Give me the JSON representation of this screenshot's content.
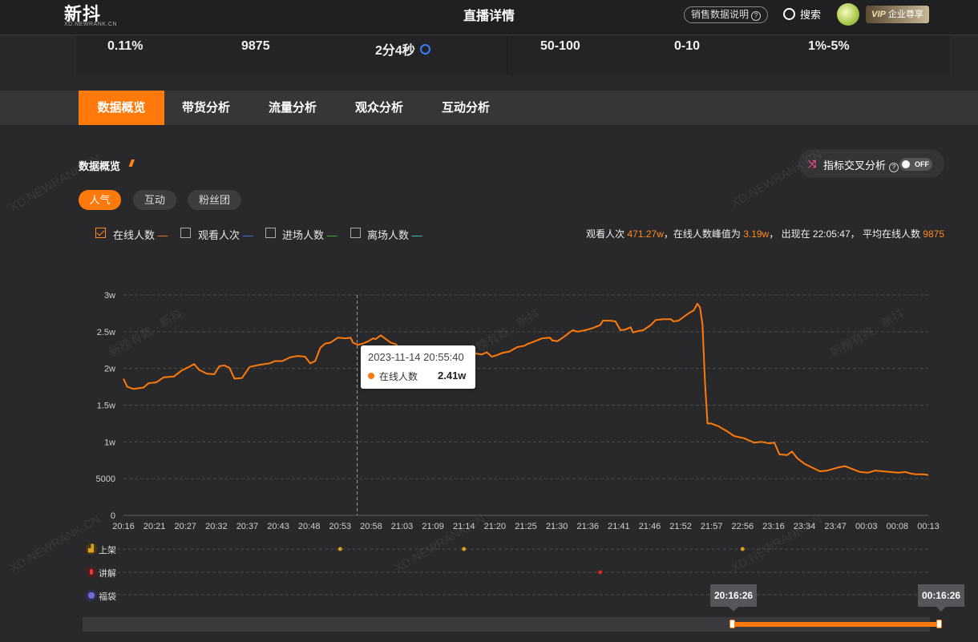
{
  "header": {
    "logo": "新抖",
    "logo_sub": "XD.NEWRANK.CN",
    "title": "直播详情",
    "sales_info": "销售数据说明",
    "search": "搜索",
    "vip_tag": "VIP",
    "vip_label": "企业尊享"
  },
  "metrics": [
    "0.11%",
    "9875",
    "2分4秒",
    "50-100",
    "0-10",
    "1%-5%"
  ],
  "tabs": [
    "数据概览",
    "带货分析",
    "流量分析",
    "观众分析",
    "互动分析"
  ],
  "section": {
    "title": "数据概览",
    "cross_analysis": "指标交叉分析",
    "toggle": "OFF",
    "pills": [
      "人气",
      "互动",
      "粉丝团"
    ]
  },
  "legend": [
    {
      "label": "在线人数",
      "color": "#ff7a0a",
      "checked": true
    },
    {
      "label": "观看人次",
      "color": "#3a7bff",
      "checked": false
    },
    {
      "label": "进场人数",
      "color": "#3fbf3f",
      "checked": false
    },
    {
      "label": "离场人数",
      "color": "#33d6c8",
      "checked": false
    }
  ],
  "summary": {
    "p1": "观看人次 ",
    "views": "471.27w",
    "p2": "，在线人数峰值为 ",
    "peak": "3.19w",
    "p3": "， 出现在 22:05:47， 平均在线人数 ",
    "avg": "9875"
  },
  "tooltip": {
    "time": "2023-11-14 20:55:40",
    "series": "在线人数",
    "value": "2.41w"
  },
  "events": [
    {
      "label": "上架",
      "icon_color": "#d9a11b",
      "icon": "cart-icon",
      "dot_color": "#d9a11b",
      "dots": [
        "20:53",
        "21:14",
        "22:56"
      ]
    },
    {
      "label": "讲解",
      "icon_color": "#e23b3b",
      "icon": "mic-icon",
      "dot_color": "#e22222",
      "dots": [
        "21:38"
      ]
    },
    {
      "label": "福袋",
      "icon_color": "#6a6ad8",
      "icon": "bag-icon",
      "dot_color": "#6a6ad8",
      "dots": []
    }
  ],
  "scrubber": {
    "start": "20:16:26",
    "end": "00:16:26"
  },
  "watermarks": [
    "XD.NEWRANK.CN",
    "新榜有数 · 新抖"
  ],
  "chart_data": {
    "type": "line",
    "series": [
      {
        "name": "在线人数",
        "color": "#ff7a0a"
      }
    ],
    "ylim": [
      0,
      30000
    ],
    "yticks": [
      "0",
      "5000",
      "1w",
      "1.5w",
      "2w",
      "2.5w",
      "3w"
    ],
    "categories": [
      "20:16",
      "20:21",
      "20:27",
      "20:32",
      "20:37",
      "20:43",
      "20:48",
      "20:53",
      "20:58",
      "21:03",
      "21:09",
      "21:14",
      "21:20",
      "21:25",
      "21:30",
      "21:36",
      "21:41",
      "21:46",
      "21:52",
      "21:57",
      "22:56",
      "23:16",
      "23:34",
      "23:47",
      "00:03",
      "00:08",
      "00:13"
    ],
    "points": [
      [
        0,
        18600
      ],
      [
        0.15,
        17500
      ],
      [
        0.4,
        17200
      ],
      [
        0.8,
        17400
      ],
      [
        1,
        18000
      ],
      [
        1.3,
        18100
      ],
      [
        1.6,
        18800
      ],
      [
        2,
        18900
      ],
      [
        2.3,
        19700
      ],
      [
        2.6,
        20200
      ],
      [
        2.8,
        20600
      ],
      [
        3,
        19800
      ],
      [
        3.3,
        19300
      ],
      [
        3.6,
        19200
      ],
      [
        3.8,
        20300
      ],
      [
        4,
        20400
      ],
      [
        4.2,
        20100
      ],
      [
        4.4,
        18600
      ],
      [
        4.7,
        18700
      ],
      [
        5,
        20200
      ],
      [
        5.4,
        20500
      ],
      [
        5.8,
        20700
      ],
      [
        6,
        21000
      ],
      [
        6.3,
        21000
      ],
      [
        6.6,
        21500
      ],
      [
        6.9,
        21700
      ],
      [
        7.2,
        21600
      ],
      [
        7.4,
        20700
      ],
      [
        7.6,
        21000
      ],
      [
        7.8,
        22800
      ],
      [
        8,
        23400
      ],
      [
        8.2,
        23500
      ],
      [
        8.5,
        24200
      ],
      [
        8.8,
        24100
      ],
      [
        9,
        24200
      ],
      [
        9.1,
        23500
      ],
      [
        9.3,
        23200
      ],
      [
        9.5,
        23400
      ],
      [
        9.7,
        23700
      ],
      [
        9.9,
        24100
      ],
      [
        10,
        24000
      ],
      [
        10.2,
        24500
      ],
      [
        10.4,
        24000
      ],
      [
        10.6,
        23500
      ],
      [
        10.8,
        23300
      ],
      [
        11,
        22500
      ],
      [
        11.3,
        22200
      ],
      [
        11.6,
        22000
      ],
      [
        11.9,
        21800
      ],
      [
        12,
        21300
      ],
      [
        12.3,
        21100
      ],
      [
        12.6,
        21000
      ],
      [
        12.9,
        21500
      ],
      [
        13,
        20300
      ],
      [
        13.2,
        21900
      ],
      [
        13.5,
        22000
      ],
      [
        13.8,
        22100
      ],
      [
        14,
        22000
      ],
      [
        14.2,
        21900
      ],
      [
        14.4,
        22200
      ],
      [
        14.6,
        21600
      ],
      [
        14.8,
        21800
      ],
      [
        15,
        22100
      ],
      [
        15.3,
        22300
      ],
      [
        15.6,
        22900
      ],
      [
        15.9,
        23100
      ],
      [
        16,
        23300
      ],
      [
        16.3,
        23700
      ],
      [
        16.6,
        24100
      ],
      [
        16.9,
        24200
      ],
      [
        17,
        23800
      ],
      [
        17.2,
        23700
      ],
      [
        17.5,
        24400
      ],
      [
        17.8,
        25200
      ],
      [
        18,
        25000
      ],
      [
        18.3,
        25200
      ],
      [
        18.6,
        25500
      ],
      [
        18.9,
        25900
      ],
      [
        19,
        26500
      ],
      [
        19.3,
        26500
      ],
      [
        19.5,
        26400
      ],
      [
        19.7,
        25200
      ],
      [
        19.9,
        25300
      ],
      [
        20.1,
        25600
      ],
      [
        20.2,
        24900
      ],
      [
        20.4,
        25100
      ],
      [
        20.6,
        25200
      ],
      [
        20.9,
        25900
      ],
      [
        21.1,
        26600
      ],
      [
        21.4,
        26700
      ],
      [
        21.7,
        26700
      ],
      [
        21.8,
        26400
      ],
      [
        22,
        26500
      ],
      [
        22.2,
        27000
      ],
      [
        22.4,
        27500
      ],
      [
        22.6,
        27900
      ],
      [
        22.75,
        28800
      ],
      [
        22.85,
        28300
      ],
      [
        22.95,
        26000
      ],
      [
        23.05,
        18000
      ],
      [
        23.15,
        12500
      ],
      [
        23.3,
        12500
      ],
      [
        23.6,
        12100
      ],
      [
        23.9,
        11500
      ],
      [
        24.2,
        10800
      ],
      [
        24.6,
        10500
      ],
      [
        24.8,
        10200
      ],
      [
        25,
        9900
      ],
      [
        25.3,
        10000
      ],
      [
        25.6,
        9800
      ],
      [
        25.8,
        9900
      ],
      [
        26,
        8300
      ],
      [
        26.3,
        8200
      ],
      [
        26.5,
        8700
      ],
      [
        26.7,
        7800
      ],
      [
        27,
        7000
      ],
      [
        27.3,
        6500
      ],
      [
        27.6,
        6000
      ],
      [
        27.9,
        6100
      ],
      [
        28.3,
        6500
      ],
      [
        28.6,
        6700
      ],
      [
        28.9,
        6300
      ],
      [
        29.2,
        5900
      ],
      [
        29.5,
        5800
      ],
      [
        29.8,
        6100
      ],
      [
        30.1,
        6000
      ],
      [
        30.4,
        5900
      ],
      [
        30.7,
        5800
      ],
      [
        31,
        5900
      ],
      [
        31.2,
        5700
      ],
      [
        31.4,
        5600
      ],
      [
        31.7,
        5600
      ],
      [
        31.9,
        5500
      ]
    ],
    "cursor_x": "20:55:40",
    "grid": true
  }
}
